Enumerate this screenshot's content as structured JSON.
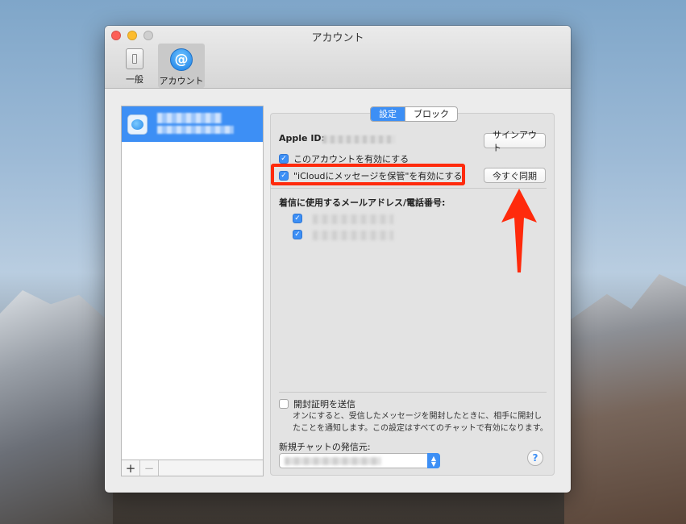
{
  "window": {
    "title": "アカウント",
    "toolbar": [
      {
        "label": "一般",
        "icon": "switch-icon"
      },
      {
        "label": "アカウント",
        "icon": "at-sign-icon"
      }
    ]
  },
  "tabs": {
    "settings": "設定",
    "block": "ブロック"
  },
  "account": {
    "apple_id_label": "Apple ID:",
    "sign_out": "サインアウト",
    "enable_account": "このアカウントを有効にする",
    "icloud_messages": "\"iCloudにメッセージを保管\"を有効にする",
    "sync_now": "今すぐ同期"
  },
  "reach": {
    "label": "着信に使用するメールアドレス/電話番号:"
  },
  "read_receipts": {
    "label": "開封証明を送信",
    "description": "オンにすると、受信したメッセージを開封したときに、相手に開封したことを通知します。この設定はすべてのチャットで有効になります。"
  },
  "new_chat": {
    "label": "新規チャットの発信元:"
  },
  "sidebar": {
    "add_label": "+",
    "remove_label": "−"
  },
  "help_label": "?",
  "colors": {
    "accent": "#3d8ff5",
    "highlight": "#ff2a0c"
  }
}
